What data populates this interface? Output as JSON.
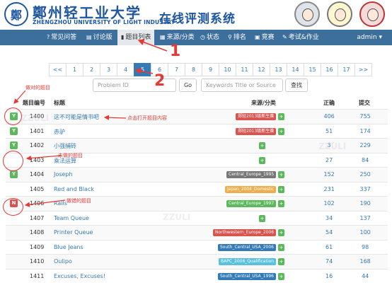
{
  "header": {
    "logo_char": "鄭",
    "logo_cn": "鄭州轻工业大学",
    "logo_en": "ZHENGZHOU UNIVERSITY OF LIGHT INDUSTRY",
    "site_title": "在线评测系统"
  },
  "nav": {
    "brand": "",
    "items": [
      {
        "icon": "?",
        "label": "常见问答"
      },
      {
        "icon": "▤",
        "label": "讨论版"
      },
      {
        "icon": "▮",
        "label": "题目列表"
      },
      {
        "icon": "▦",
        "label": "来源/分类"
      },
      {
        "icon": "◷",
        "label": "状态"
      },
      {
        "icon": "⚲",
        "label": "排名"
      },
      {
        "icon": "▣",
        "label": "竞赛"
      },
      {
        "icon": "✎",
        "label": "考试&作业"
      }
    ],
    "admin": "admin ▾"
  },
  "pagination": {
    "prev": "<<",
    "pages": [
      "1",
      "2",
      "3",
      "4",
      "5",
      "6",
      "7",
      "8",
      "9",
      "10",
      "11",
      "12",
      "13",
      "14",
      "15",
      "16",
      "17"
    ],
    "next": ">>",
    "active_page": "5"
  },
  "search": {
    "id_placeholder": "Problem ID",
    "go_label": "Go",
    "keyword_placeholder": "Keywords Title or Source",
    "search_label": "查找"
  },
  "table": {
    "headers": {
      "id": "题目编号",
      "title": "标题",
      "source": "来源/分类",
      "accepted": "正确",
      "submit": "提交"
    },
    "rows": [
      {
        "status": "Y",
        "id": "1400",
        "title": "这不可能是情书吧",
        "source": "郑轻2013级新生赛",
        "source_color": "#d9534f",
        "accepted": "406",
        "submit": "755"
      },
      {
        "status": "Y",
        "id": "1401",
        "title": "赤驴",
        "source": "郑轻2013级新生赛",
        "source_color": "#d9534f",
        "accepted": "51",
        "submit": "174"
      },
      {
        "status": "Y",
        "id": "1402",
        "title": "小强捕砖",
        "source": "",
        "source_color": "",
        "accepted": "3",
        "submit": "229"
      },
      {
        "status": "",
        "id": "1403",
        "title": "乘法运算",
        "source": "",
        "source_color": "",
        "accepted": "27",
        "submit": "84"
      },
      {
        "status": "Y",
        "id": "1404",
        "title": "Joseph",
        "source": "Central_Europe_1995",
        "source_color": "#777777",
        "accepted": "152",
        "submit": "250"
      },
      {
        "status": "",
        "id": "1405",
        "title": "Red and Black",
        "source": "Japan_2004_Domestic",
        "source_color": "#f0ad4e",
        "accepted": "231",
        "submit": "337"
      },
      {
        "status": "N",
        "id": "1406",
        "title": "Rails",
        "source": "Central_Europe_1997",
        "source_color": "#5cb85c",
        "accepted": "102",
        "submit": "190"
      },
      {
        "status": "",
        "id": "1407",
        "title": "Team Queue",
        "source": "",
        "source_color": "",
        "accepted": "34",
        "submit": "137"
      },
      {
        "status": "",
        "id": "1408",
        "title": "Printer Queue",
        "source": "Northwestern_Europe_2006",
        "source_color": "#d9534f",
        "accepted": "54",
        "submit": "100"
      },
      {
        "status": "",
        "id": "1409",
        "title": "Blue Jeans",
        "source": "South_Central_USA_2006",
        "source_color": "#337ab7",
        "accepted": "61",
        "submit": "98"
      },
      {
        "status": "",
        "id": "1410",
        "title": "Oulipo",
        "source": "BAPC_2006_Qualification",
        "source_color": "#5bc0de",
        "accepted": "74",
        "submit": "168"
      },
      {
        "status": "",
        "id": "1411",
        "title": "Excuses, Excuses!",
        "source": "South_Central_USA_1996",
        "source_color": "#337ab7",
        "accepted": "16",
        "submit": "44"
      }
    ],
    "plus_label": "+"
  },
  "annotations": {
    "step1": "1",
    "step2": "2",
    "correct_label": "做对的题目",
    "undone_label": "未做的题目",
    "wrong_label": "做错的题目",
    "open_label": "点击打开题目内容"
  },
  "colors": {
    "accent": "#337ab7",
    "nav": "#3d6f9c",
    "brand": "#1e56a0",
    "annotation": "#e53935"
  }
}
